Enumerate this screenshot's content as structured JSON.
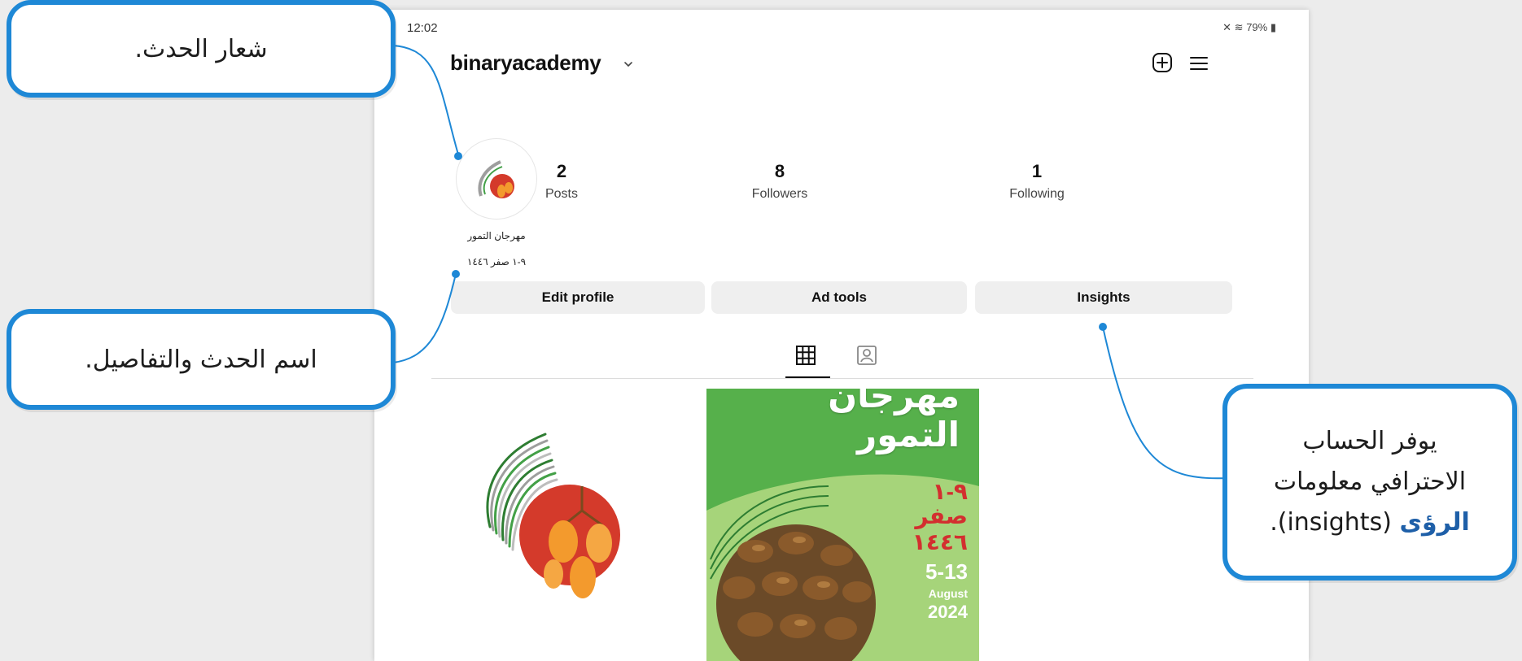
{
  "status_bar": {
    "time": "12:02",
    "icons_text": "79%"
  },
  "profile": {
    "username": "binaryacademy",
    "bio_name": "مهرجان التمور",
    "bio_detail": "٩-١ صفر ١٤٤٦",
    "stats": [
      {
        "value": "2",
        "label": "Posts"
      },
      {
        "value": "8",
        "label": "Followers"
      },
      {
        "value": "1",
        "label": "Following"
      }
    ]
  },
  "buttons": {
    "edit": "Edit profile",
    "ad_tools": "Ad tools",
    "insights": "Insights"
  },
  "tabs": {
    "grid": "grid-icon",
    "tagged": "tagged-icon"
  },
  "posts": {
    "poster_title_line1": "مهرجان",
    "poster_title_line2": "التمور",
    "poster_date_ar_1": "٩-١",
    "poster_date_ar_2": "صفر",
    "poster_date_ar_3": "١٤٤٦",
    "poster_date_en_days": "5-13",
    "poster_date_en_month": "August",
    "poster_date_en_year": "2024"
  },
  "callouts": {
    "logo": "شعار الحدث.",
    "name_details": "اسم الحدث والتفاصيل.",
    "insights_line1": "يوفر الحساب",
    "insights_line2": "الاحترافي معلومات",
    "insights_line3_bold": "الرؤى",
    "insights_line3_rest": " (insights)."
  },
  "colors": {
    "callout_border": "#1e88d6",
    "poster_green": "#4caf50",
    "poster_light": "#a6d47a",
    "poster_red": "#d32f2f",
    "logo_red": "#d43a2b",
    "logo_orange": "#f39a2d"
  }
}
